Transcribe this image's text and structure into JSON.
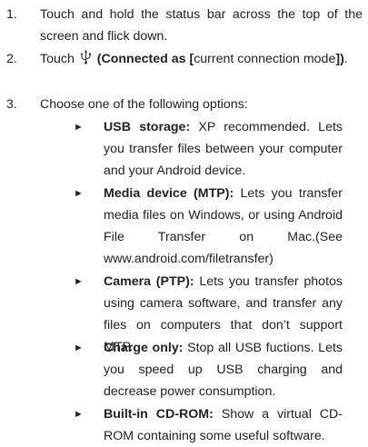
{
  "steps": [
    {
      "number": "1.",
      "text": "Touch and hold the status bar across the top of the screen and flick down."
    },
    {
      "number": "2.",
      "prefix": "Touch ",
      "icon": "usb-icon",
      "bold_open": " (Connected as [",
      "normal_mid": "current connection mode",
      "bold_close": "])",
      "suffix": "."
    },
    {
      "number": "3.",
      "text": "Choose one of the following options:"
    }
  ],
  "options": [
    {
      "bullet": "►",
      "title": "USB storage:",
      "description": " XP recommended. Lets you transfer files between your computer and your Android device."
    },
    {
      "bullet": "►",
      "title": "Media device (MTP):",
      "description": " Lets you transfer media files on Windows, or using Android File Transfer on Mac.(See www.android.com/filetransfer)"
    },
    {
      "bullet": "►",
      "title": "Camera (PTP):",
      "description": " Lets you transfer photos using camera software, and transfer any files on computers that don’t support MTP."
    },
    {
      "bullet": "►",
      "title": "Charge only:",
      "description": " Stop all USB fuctions. Lets you speed up USB charging and decrease power consumption."
    },
    {
      "bullet": "►",
      "title": "Built-in CD-ROM:",
      "description": " Show a virtual CD-ROM containing some useful software."
    }
  ]
}
